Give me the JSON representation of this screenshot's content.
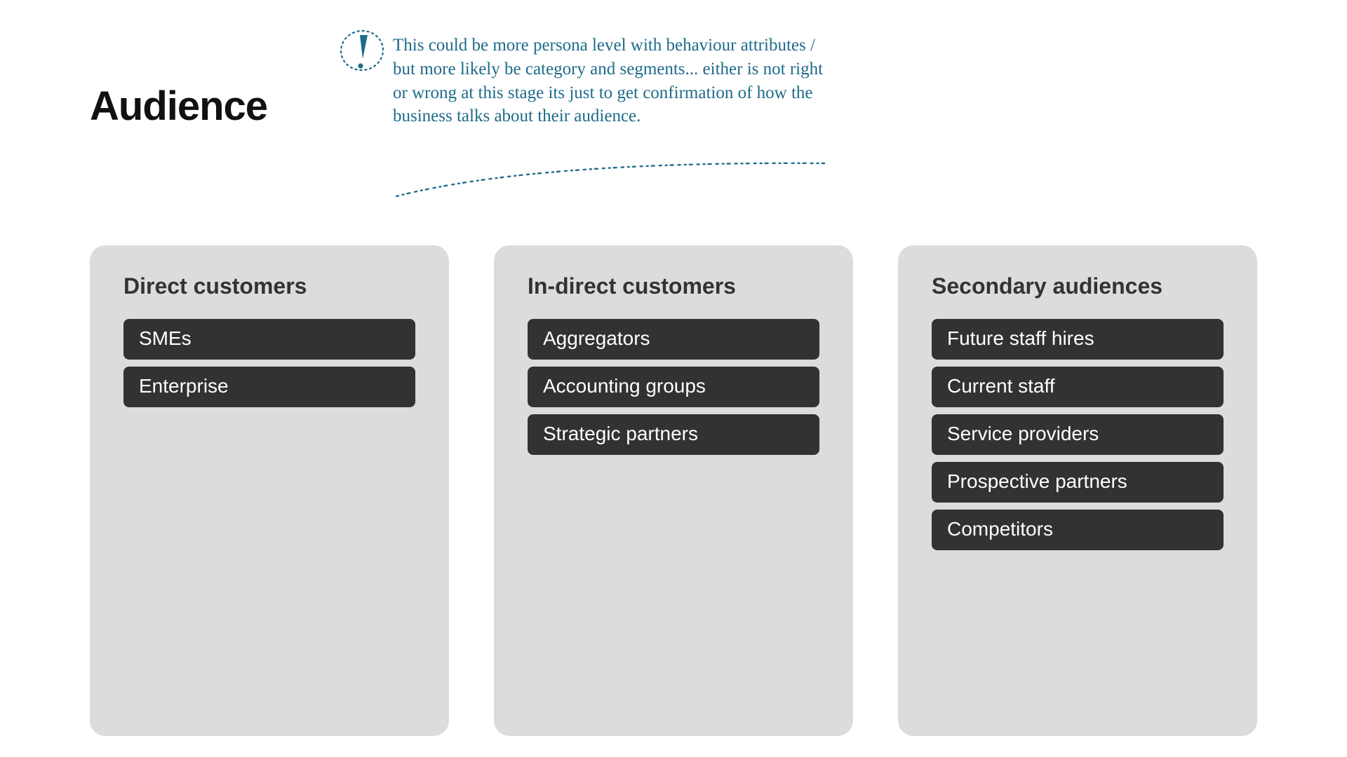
{
  "title": "Audience",
  "annotation": {
    "text": "This could be more persona level with behaviour attributes / but more likely be category and segments... either is not right or wrong at this stage its just to get confirmation of how the business talks about their audience.",
    "icon": "exclamation-circle-icon",
    "accent_color": "#1f6b8a"
  },
  "columns": [
    {
      "title": "Direct customers",
      "items": [
        "SMEs",
        "Enterprise"
      ]
    },
    {
      "title": "In-direct customers",
      "items": [
        "Aggregators",
        "Accounting groups",
        "Strategic partners"
      ]
    },
    {
      "title": "Secondary audiences",
      "items": [
        "Future staff hires",
        "Current staff",
        "Service providers",
        "Prospective partners",
        "Competitors"
      ]
    }
  ]
}
